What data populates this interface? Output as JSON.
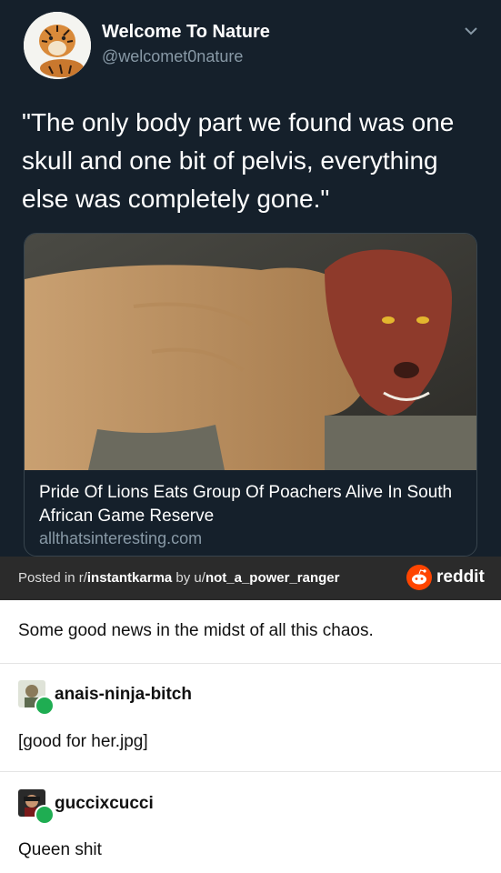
{
  "tweet": {
    "author_name": "Welcome To Nature",
    "author_handle": "@welcomet0nature",
    "text": "\"The only body part we found was one skull and one bit of pelvis, everything else was completely gone.\"",
    "card": {
      "title": "Pride Of Lions Eats Group Of Poachers Alive In South African Game Reserve",
      "domain": "allthatsinteresting.com"
    }
  },
  "reddit_bar": {
    "posted_in": "Posted in r/",
    "subreddit": "instantkarma",
    "by": " by u/",
    "username": "not_a_power_ranger",
    "brand": "reddit"
  },
  "post": {
    "text": "Some good news in the midst of all this chaos."
  },
  "comments": [
    {
      "username": "anais-ninja-bitch",
      "text": "[good for her.jpg]"
    },
    {
      "username": "guccixcucci",
      "text": "Queen shit"
    }
  ],
  "colors": {
    "tweet_bg": "#15202b",
    "reddit_bar_bg": "#2b2b2b",
    "reddit_orange": "#ff4500",
    "reblog_green": "#1fad52"
  }
}
